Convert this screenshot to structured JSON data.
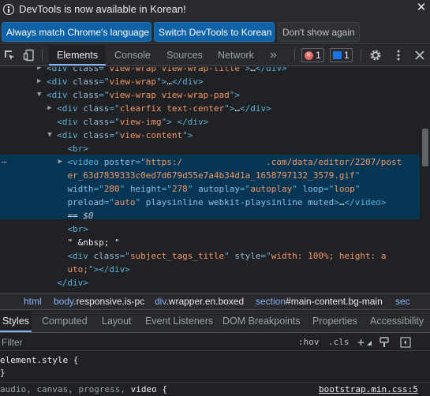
{
  "infobar": {
    "message": "DevTools is now available in Korean!",
    "match_language_label": "Always match Chrome's language",
    "switch_label": "Switch DevTools to Korean",
    "dismiss_label": "Don't show again",
    "close_glyph": "✕"
  },
  "toolbar": {
    "tabs": [
      "Elements",
      "Console",
      "Sources",
      "Network"
    ],
    "more_glyph": "»",
    "errors_count": "1",
    "messages_count": "1"
  },
  "dom": {
    "lines": [
      {
        "indent": 8,
        "arrow": "▶",
        "parts": [
          [
            "tag",
            "<div "
          ],
          [
            "attr",
            "class"
          ],
          [
            "tag",
            "=\""
          ],
          [
            "val",
            "view-wrap view-wrap-title"
          ],
          [
            "tag",
            "\">"
          ],
          [
            "txt",
            "…"
          ],
          [
            "tag",
            "</div>"
          ]
        ]
      },
      {
        "indent": 8,
        "arrow": "▶",
        "parts": [
          [
            "tag",
            "<div "
          ],
          [
            "attr",
            "class"
          ],
          [
            "tag",
            "=\""
          ],
          [
            "val",
            "view-wrap"
          ],
          [
            "tag",
            "\">"
          ],
          [
            "txt",
            "…"
          ],
          [
            "tag",
            "</div>"
          ]
        ]
      },
      {
        "indent": 8,
        "arrow": "▼",
        "parts": [
          [
            "tag",
            "<div "
          ],
          [
            "attr",
            "class"
          ],
          [
            "tag",
            "=\""
          ],
          [
            "val",
            "view-wrap view-wrap-pad"
          ],
          [
            "tag",
            "\">"
          ]
        ]
      },
      {
        "indent": 10,
        "arrow": "▶",
        "parts": [
          [
            "tag",
            "<div "
          ],
          [
            "attr",
            "class"
          ],
          [
            "tag",
            "=\""
          ],
          [
            "val",
            "clearfix text-center"
          ],
          [
            "tag",
            "\">"
          ],
          [
            "txt",
            "…"
          ],
          [
            "tag",
            "</div>"
          ]
        ]
      },
      {
        "indent": 10,
        "arrow": "",
        "parts": [
          [
            "tag",
            "<div "
          ],
          [
            "attr",
            "class"
          ],
          [
            "tag",
            "=\""
          ],
          [
            "val",
            "view-img"
          ],
          [
            "tag",
            "\"> </div>"
          ]
        ]
      },
      {
        "indent": 10,
        "arrow": "▼",
        "parts": [
          [
            "tag",
            "<div "
          ],
          [
            "attr",
            "class"
          ],
          [
            "tag",
            "=\""
          ],
          [
            "val",
            "view-content"
          ],
          [
            "tag",
            "\">"
          ]
        ]
      },
      {
        "indent": 12,
        "arrow": "",
        "parts": [
          [
            "tag",
            "<br>"
          ]
        ]
      },
      {
        "indent": 12,
        "arrow": "▶",
        "parts": [
          [
            "tag",
            "<video "
          ],
          [
            "attr",
            "poster"
          ],
          [
            "tag",
            "=\""
          ],
          [
            "val",
            "https:/                .com/data/editor/2207/post"
          ]
        ]
      },
      {
        "indent": 12,
        "arrow": "",
        "parts": [
          [
            "val",
            "er_63d7839333c0ed7d679d55e7a4b34d1a_1658797132_3579.gif"
          ],
          [
            "tag",
            "\""
          ]
        ]
      },
      {
        "indent": 12,
        "arrow": "",
        "parts": [
          [
            "attr",
            "width"
          ],
          [
            "tag",
            "=\""
          ],
          [
            "val",
            "280"
          ],
          [
            "tag",
            "\" "
          ],
          [
            "attr",
            "height"
          ],
          [
            "tag",
            "=\""
          ],
          [
            "val",
            "278"
          ],
          [
            "tag",
            "\" "
          ],
          [
            "attr",
            "autoplay"
          ],
          [
            "tag",
            "=\""
          ],
          [
            "val",
            "autoplay"
          ],
          [
            "tag",
            "\" "
          ],
          [
            "attr",
            "loop"
          ],
          [
            "tag",
            "=\""
          ],
          [
            "val",
            "loop"
          ],
          [
            "tag",
            "\""
          ]
        ]
      },
      {
        "indent": 12,
        "arrow": "",
        "parts": [
          [
            "attr",
            "preload"
          ],
          [
            "tag",
            "=\""
          ],
          [
            "val",
            "auto"
          ],
          [
            "tag",
            "\" "
          ],
          [
            "attr",
            "playsinline webkit-playsinline muted"
          ],
          [
            "tag",
            ">"
          ],
          [
            "txt",
            "…"
          ],
          [
            "tag",
            "</video>"
          ]
        ]
      },
      {
        "indent": 12,
        "arrow": "",
        "parts": [
          [
            "txt",
            "== "
          ],
          [
            "txt",
            "$0"
          ]
        ]
      },
      {
        "indent": 12,
        "arrow": "",
        "parts": [
          [
            "tag",
            "<br>"
          ]
        ]
      },
      {
        "indent": 12,
        "arrow": "",
        "parts": [
          [
            "txt",
            "\" &nbsp; \""
          ]
        ]
      },
      {
        "indent": 12,
        "arrow": "",
        "parts": [
          [
            "tag",
            "<div "
          ],
          [
            "attr",
            "class"
          ],
          [
            "tag",
            "=\""
          ],
          [
            "val",
            "subject_tags_title"
          ],
          [
            "tag",
            "\" "
          ],
          [
            "attr",
            "style"
          ],
          [
            "tag",
            "=\""
          ],
          [
            "val",
            "width: 100%; height: a"
          ]
        ]
      },
      {
        "indent": 12,
        "arrow": "",
        "parts": [
          [
            "val",
            "uto;"
          ],
          [
            "tag",
            "\"></div>"
          ]
        ]
      },
      {
        "indent": 10,
        "arrow": "",
        "parts": [
          [
            "tag",
            "</div>"
          ]
        ]
      }
    ],
    "gutter_ellipsis": "⋯"
  },
  "breadcrumb": {
    "items": [
      {
        "tag": "html",
        "rest": ""
      },
      {
        "tag": "body",
        "rest": ".responsive.is-pc"
      },
      {
        "tag": "div",
        "rest": ".wrapper.en.boxed"
      },
      {
        "tag": "section",
        "rest": "#main-content.bg-main"
      },
      {
        "tag": "sec",
        "rest": ""
      }
    ]
  },
  "styles_tabs": [
    "Styles",
    "Computed",
    "Layout",
    "Event Listeners",
    "DOM Breakpoints",
    "Properties",
    "Accessibility"
  ],
  "filter": {
    "placeholder": "Filter",
    "hov_label": ":hov",
    "cls_label": ".cls",
    "plus_glyph": "+"
  },
  "styles": {
    "element_style_selector": "element.style {",
    "element_style_close": "}",
    "rule_selector": "audio, canvas, progress, video {",
    "rule_source": "bootstrap.min.css:5"
  },
  "colors": {
    "accent": "#8ab4f8",
    "selection": "#073655",
    "primary_button": "#0f62a6",
    "tag": "#5db0d7",
    "attr": "#9bbbdc",
    "value": "#f29766"
  }
}
